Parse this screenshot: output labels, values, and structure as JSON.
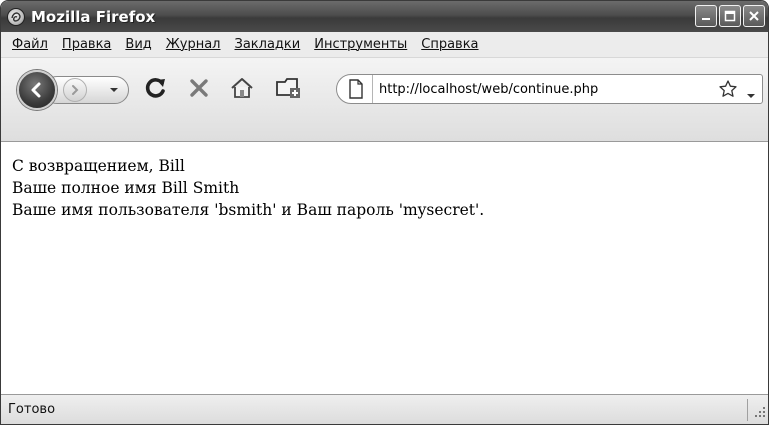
{
  "window": {
    "title": "Mozilla Firefox"
  },
  "menu": {
    "items": [
      "Файл",
      "Правка",
      "Вид",
      "Журнал",
      "Закладки",
      "Инструменты",
      "Справка"
    ]
  },
  "toolbar": {
    "icons": [
      "back-icon",
      "forward-icon",
      "history-dropdown-icon",
      "reload-icon",
      "stop-icon",
      "home-icon",
      "bookmark-tab-icon"
    ],
    "url": "http://localhost/web/continue.php"
  },
  "content": {
    "lines": [
      "С возвращением, Bill",
      "Ваше полное имя Bill Smith",
      "Ваше имя пользователя 'bsmith' и Ваш пароль 'mysecret'."
    ]
  },
  "status": {
    "text": "Готово"
  },
  "colors": {
    "titlebar": "#4d4d4d",
    "toolbar": "#e8e8e8",
    "statusbar": "#e4e4e4"
  }
}
